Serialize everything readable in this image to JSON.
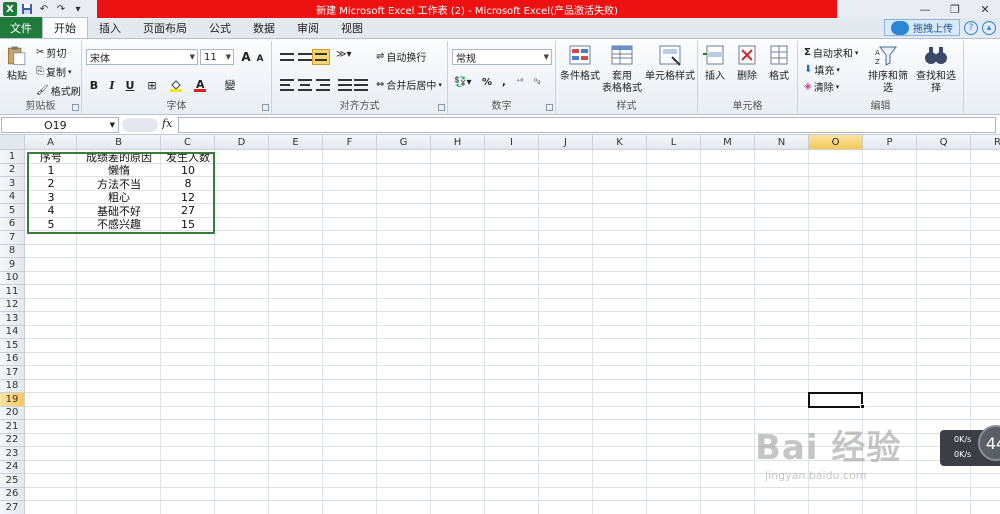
{
  "title_bar": {
    "app_icon": "X",
    "title": "新建 Microsoft Excel 工作表 (2) - Microsoft Excel(产品激活失败)",
    "min_icon": "—",
    "restore_icon": "❐",
    "close_icon": "✕"
  },
  "tabs": {
    "file": "文件",
    "items": [
      "开始",
      "插入",
      "页面布局",
      "公式",
      "数据",
      "审阅",
      "视图"
    ],
    "active": "开始",
    "upload_label": "拖拽上传",
    "help_icon": "?"
  },
  "ribbon": {
    "clipboard": {
      "label": "剪贴板",
      "paste": "粘贴",
      "cut": "剪切",
      "copy": "复制",
      "format_painter": "格式刷"
    },
    "font": {
      "label": "字体",
      "font_name": "宋体",
      "font_size": "11",
      "grow": "A",
      "shrink": "A",
      "bold": "B",
      "italic": "I",
      "underline": "U",
      "wen": "變"
    },
    "alignment": {
      "label": "对齐方式",
      "wrap_text": "自动换行",
      "merge_center": "合并后居中"
    },
    "number": {
      "label": "数字",
      "format": "常规",
      "percent": "%",
      "comma": ","
    },
    "styles": {
      "label": "样式",
      "conditional": "条件格式",
      "table_format_1": "套用",
      "table_format_2": "表格格式",
      "cell_styles": "单元格样式"
    },
    "cells": {
      "label": "单元格",
      "insert": "插入",
      "delete": "删除",
      "format": "格式"
    },
    "editing": {
      "label": "编辑",
      "autosum": "自动求和",
      "fill": "填充",
      "clear": "清除",
      "sort_filter": "排序和筛选",
      "find_select": "查找和选择"
    }
  },
  "formula_bar": {
    "name_box": "O19",
    "fx": "fx",
    "formula": ""
  },
  "columns": [
    "A",
    "B",
    "C",
    "D",
    "E",
    "F",
    "G",
    "H",
    "I",
    "J",
    "K",
    "L",
    "M",
    "N",
    "O",
    "P",
    "Q",
    "R"
  ],
  "rows": [
    "1",
    "2",
    "3",
    "4",
    "5",
    "6",
    "7",
    "8",
    "9",
    "10",
    "11",
    "12",
    "13",
    "14",
    "15",
    "16",
    "17",
    "18",
    "19",
    "20",
    "21",
    "22",
    "23",
    "24",
    "25",
    "26",
    "27"
  ],
  "selected_cell": {
    "column": "O",
    "row": "19"
  },
  "sheet": {
    "headers": [
      "序号",
      "成绩差的原因",
      "发生人数"
    ],
    "rows": [
      [
        "1",
        "懒惰",
        "10"
      ],
      [
        "2",
        "方法不当",
        "8"
      ],
      [
        "3",
        "粗心",
        "12"
      ],
      [
        "4",
        "基础不好",
        "27"
      ],
      [
        "5",
        "不感兴趣",
        "15"
      ]
    ]
  },
  "watermark": {
    "main": "Bai 经验",
    "sub": "jingyan.baidu.com"
  },
  "net_widget": {
    "up": "0K/s",
    "down": "0K/s",
    "value": "44"
  }
}
